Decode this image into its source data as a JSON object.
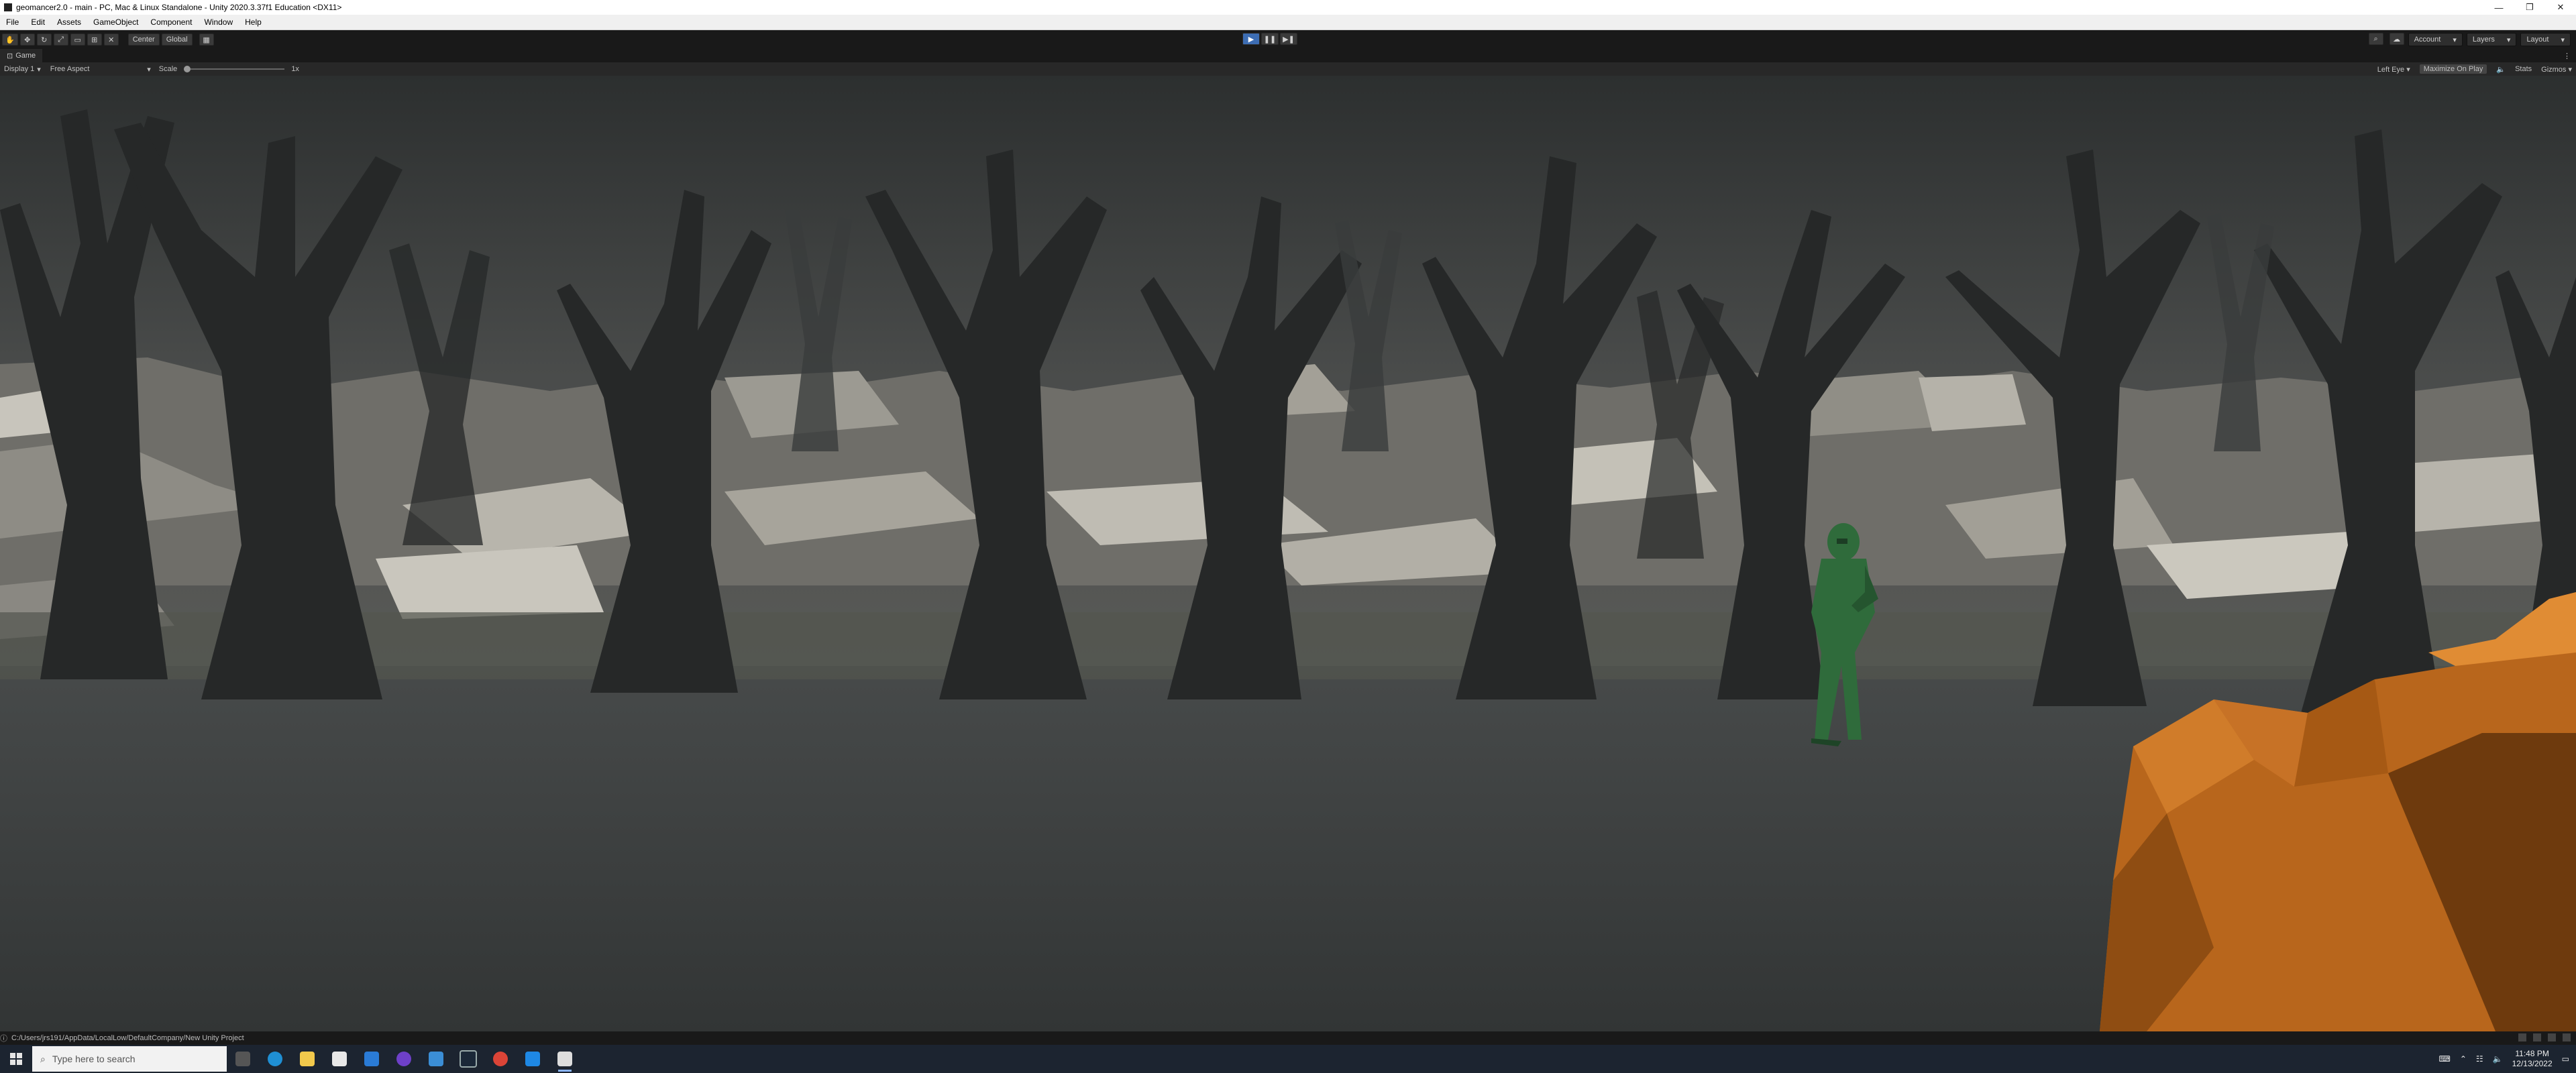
{
  "window": {
    "title": "geomancer2.0 - main - PC, Mac & Linux Standalone - Unity 2020.3.37f1 Education <DX11>",
    "controls": [
      "—",
      "❐",
      "✕"
    ]
  },
  "menu": [
    "File",
    "Edit",
    "Assets",
    "GameObject",
    "Component",
    "Window",
    "Help"
  ],
  "toolbar": {
    "pivot_center": "Center",
    "pivot_global": "Global",
    "right": {
      "account": "Account",
      "layers": "Layers",
      "layout": "Layout"
    }
  },
  "tab": {
    "label": "Game"
  },
  "gamebar": {
    "display": "Display 1",
    "aspect": "Free Aspect",
    "scale_label": "Scale",
    "scale_value": "1x",
    "eye": "Left Eye",
    "maximize": "Maximize On Play",
    "stats": "Stats",
    "gizmos": "Gizmos"
  },
  "status": {
    "path": "C:/Users/jrs191/AppData/LocalLow/DefaultCompany/New Unity Project"
  },
  "taskbar": {
    "search_placeholder": "Type here to search",
    "time": "11:48 PM",
    "date": "12/13/2022"
  },
  "colors": {
    "play_active": "#3d6db3",
    "tree_trunk": "#262828",
    "rock_light": "#b9b6ad",
    "ground": "#3b3d3d",
    "character": "#2f6b3b",
    "hand": "#b8661c"
  }
}
